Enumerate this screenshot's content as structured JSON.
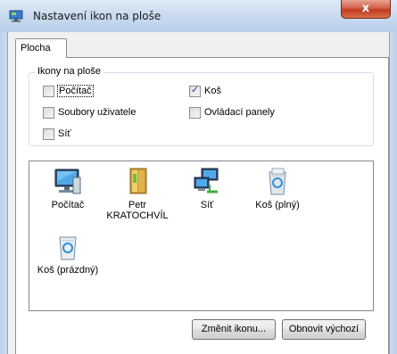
{
  "window": {
    "title": "Nastavení ikon na ploše",
    "close_glyph": "x"
  },
  "tabs": [
    {
      "label": "Plocha",
      "selected": true
    }
  ],
  "group": {
    "legend": "Ikony na ploše",
    "checkboxes": [
      {
        "label": "Počítač",
        "checked": false
      },
      {
        "label": "Koš",
        "checked": true
      },
      {
        "label": "Soubory uživatele",
        "checked": false
      },
      {
        "label": "Ovládací panely",
        "checked": false
      },
      {
        "label": "Síť",
        "checked": false
      }
    ]
  },
  "icons": [
    {
      "label": "Počítač",
      "icon": "computer-icon"
    },
    {
      "label": "Petr KRATOCHVÍL",
      "icon": "user-folder-icon"
    },
    {
      "label": "Síť",
      "icon": "network-icon"
    },
    {
      "label": "Koš (plný)",
      "icon": "recycle-bin-full-icon"
    },
    {
      "label": "Koš (prázdný)",
      "icon": "recycle-bin-empty-icon"
    }
  ],
  "buttons": {
    "change_icon": "Změnit ikonu...",
    "restore_default": "Obnovit výchozí"
  },
  "colors": {
    "frame": "#c9dcef",
    "close": "#c2391f",
    "panel": "#ffffff",
    "dialog": "#f0f0f0"
  }
}
